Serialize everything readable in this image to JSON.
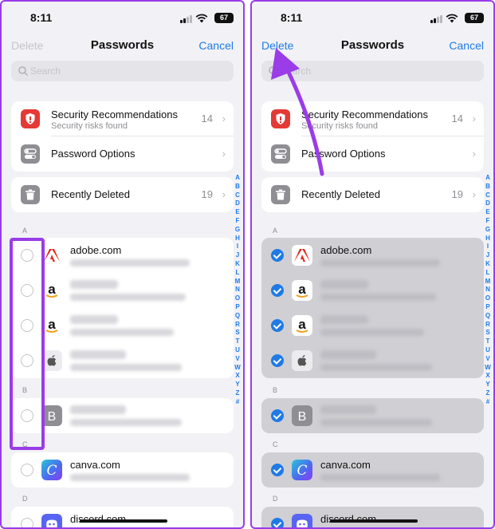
{
  "screens": [
    {
      "status": {
        "time": "8:11",
        "battery": "67"
      },
      "nav": {
        "left": "Delete",
        "title": "Passwords",
        "right": "Cancel"
      },
      "search": {
        "placeholder": "Search"
      },
      "security": {
        "title": "Security Recommendations",
        "subtitle": "Security risks found",
        "count": "14"
      },
      "options": {
        "title": "Password Options"
      },
      "deleted": {
        "title": "Recently Deleted",
        "count": "19"
      },
      "sections": {
        "a": "A",
        "b": "B",
        "c": "C",
        "d": "D"
      },
      "sites": {
        "adobe": "adobe.com",
        "canva": "canva.com",
        "discord": "discord.com"
      },
      "selected": false
    },
    {
      "status": {
        "time": "8:11",
        "battery": "67"
      },
      "nav": {
        "left": "Delete",
        "title": "Passwords",
        "right": "Cancel"
      },
      "search": {
        "placeholder": "Search"
      },
      "security": {
        "title": "Security Recommendations",
        "subtitle": "Security risks found",
        "count": "14"
      },
      "options": {
        "title": "Password Options"
      },
      "deleted": {
        "title": "Recently Deleted",
        "count": "19"
      },
      "sections": {
        "a": "A",
        "b": "B",
        "c": "C",
        "d": "D"
      },
      "sites": {
        "adobe": "adobe.com",
        "canva": "canva.com",
        "discord": "discord.com"
      },
      "selected": true
    }
  ],
  "index_letters": [
    "A",
    "B",
    "C",
    "D",
    "E",
    "F",
    "G",
    "H",
    "I",
    "J",
    "K",
    "L",
    "M",
    "N",
    "O",
    "P",
    "Q",
    "R",
    "S",
    "T",
    "U",
    "V",
    "W",
    "X",
    "Y",
    "Z",
    "#"
  ],
  "icons": {
    "security": "shield-icon",
    "options": "toggles-icon",
    "deleted": "trash-icon",
    "adobe": "adobe-logo-icon",
    "amazon": "amazon-logo-icon",
    "apple": "apple-logo-icon",
    "b_placeholder": "letter-b-icon",
    "canva": "canva-logo-icon",
    "discord": "discord-logo-icon"
  },
  "colors": {
    "accent": "#1f7ae6",
    "annotation": "#9a3ce8",
    "security": "#e53935",
    "gray_icon": "#8e8e93"
  }
}
